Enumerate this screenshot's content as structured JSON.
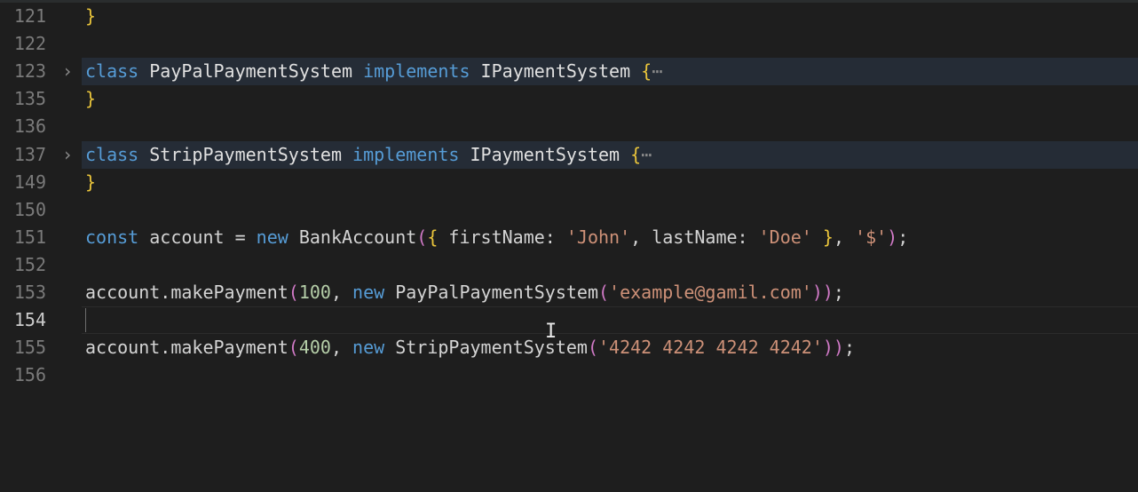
{
  "editor": {
    "lines": [
      {
        "num": "121",
        "tokens": [
          {
            "t": "}",
            "c": "brace"
          }
        ]
      },
      {
        "num": "122",
        "tokens": []
      },
      {
        "num": "123",
        "fold": "›",
        "highlight": true,
        "tokens": [
          {
            "t": "class",
            "c": "kw"
          },
          {
            "t": " PayPalPaymentSystem ",
            "c": "cls"
          },
          {
            "t": "implements",
            "c": "kw"
          },
          {
            "t": " IPaymentSystem ",
            "c": "cls"
          },
          {
            "t": "{",
            "c": "brace"
          },
          {
            "t": "⋯",
            "c": "ellip"
          }
        ]
      },
      {
        "num": "135",
        "tokens": [
          {
            "t": "}",
            "c": "brace"
          }
        ]
      },
      {
        "num": "136",
        "tokens": []
      },
      {
        "num": "137",
        "fold": "›",
        "highlight": true,
        "tokens": [
          {
            "t": "class",
            "c": "kw"
          },
          {
            "t": " StripPaymentSystem ",
            "c": "cls"
          },
          {
            "t": "implements",
            "c": "kw"
          },
          {
            "t": " IPaymentSystem ",
            "c": "cls"
          },
          {
            "t": "{",
            "c": "brace"
          },
          {
            "t": "⋯",
            "c": "ellip"
          }
        ]
      },
      {
        "num": "149",
        "tokens": [
          {
            "t": "}",
            "c": "brace"
          }
        ]
      },
      {
        "num": "150",
        "tokens": []
      },
      {
        "num": "151",
        "tokens": [
          {
            "t": "const",
            "c": "kw"
          },
          {
            "t": " account = ",
            "c": "plain"
          },
          {
            "t": "new",
            "c": "kw"
          },
          {
            "t": " BankAccount",
            "c": "plain"
          },
          {
            "t": "(",
            "c": "paren"
          },
          {
            "t": "{",
            "c": "brace"
          },
          {
            "t": " firstName: ",
            "c": "plain"
          },
          {
            "t": "'John'",
            "c": "str"
          },
          {
            "t": ", lastName: ",
            "c": "plain"
          },
          {
            "t": "'Doe'",
            "c": "str"
          },
          {
            "t": " ",
            "c": "plain"
          },
          {
            "t": "}",
            "c": "brace"
          },
          {
            "t": ", ",
            "c": "plain"
          },
          {
            "t": "'$'",
            "c": "str"
          },
          {
            "t": ")",
            "c": "paren"
          },
          {
            "t": ";",
            "c": "plain"
          }
        ]
      },
      {
        "num": "152",
        "tokens": []
      },
      {
        "num": "153",
        "tokens": [
          {
            "t": "account.makePayment",
            "c": "plain"
          },
          {
            "t": "(",
            "c": "paren"
          },
          {
            "t": "100",
            "c": "num"
          },
          {
            "t": ", ",
            "c": "plain"
          },
          {
            "t": "new",
            "c": "kw"
          },
          {
            "t": " PayPalPaymentSystem",
            "c": "plain"
          },
          {
            "t": "(",
            "c": "paren"
          },
          {
            "t": "'example@gamil.com'",
            "c": "str"
          },
          {
            "t": ")",
            "c": "paren"
          },
          {
            "t": ")",
            "c": "paren"
          },
          {
            "t": ";",
            "c": "plain"
          }
        ]
      },
      {
        "num": "154",
        "active": true,
        "tokens": []
      },
      {
        "num": "155",
        "tokens": [
          {
            "t": "account.makePayment",
            "c": "plain"
          },
          {
            "t": "(",
            "c": "paren"
          },
          {
            "t": "400",
            "c": "num"
          },
          {
            "t": ", ",
            "c": "plain"
          },
          {
            "t": "new",
            "c": "kw"
          },
          {
            "t": " StripPaymentSystem",
            "c": "plain"
          },
          {
            "t": "(",
            "c": "paren"
          },
          {
            "t": "'4242 4242 4242 4242'",
            "c": "str"
          },
          {
            "t": ")",
            "c": "paren"
          },
          {
            "t": ")",
            "c": "paren"
          },
          {
            "t": ";",
            "c": "plain"
          }
        ]
      },
      {
        "num": "156",
        "tokens": []
      }
    ]
  }
}
